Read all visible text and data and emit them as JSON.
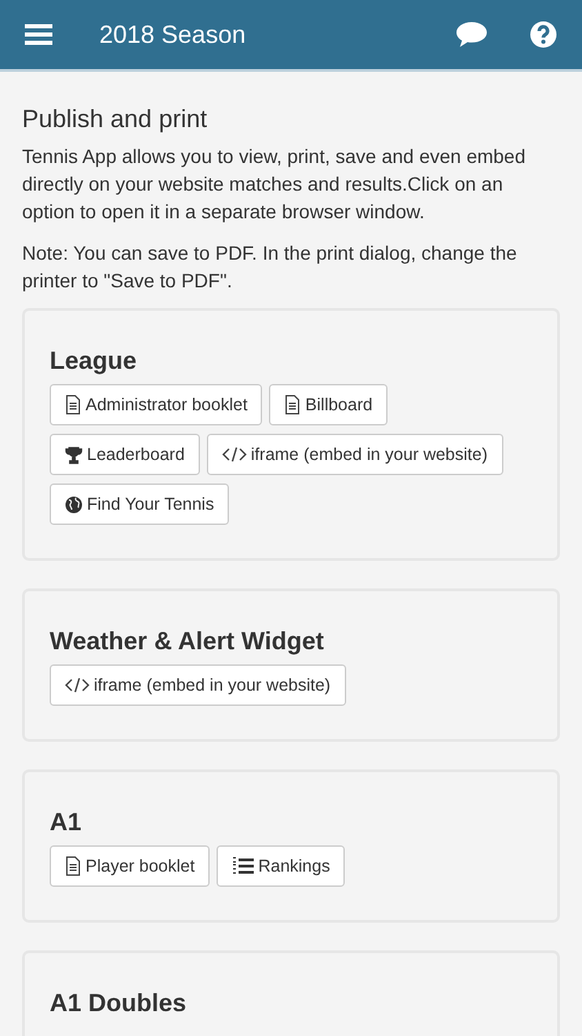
{
  "header": {
    "title": "2018 Season"
  },
  "intro": {
    "heading": "Publish and print",
    "paragraphs": [
      "Tennis App allows you to view, print, save and even embed directly on your website matches and results.Click on an option to open it in a separate browser window.",
      "Note: You can save to PDF. In the print dialog, change the printer to \"Save to PDF\"."
    ]
  },
  "sections": [
    {
      "title": "League",
      "buttons": [
        {
          "kind": "document",
          "label": "Administrator booklet"
        },
        {
          "kind": "document",
          "label": "Billboard"
        },
        {
          "kind": "trophy",
          "label": "Leaderboard"
        },
        {
          "kind": "code",
          "label": "iframe (embed in your website)"
        },
        {
          "kind": "globe",
          "label": "Find Your Tennis"
        }
      ]
    },
    {
      "title": "Weather & Alert Widget",
      "buttons": [
        {
          "kind": "code",
          "label": "iframe (embed in your website)"
        }
      ]
    },
    {
      "title": "A1",
      "buttons": [
        {
          "kind": "document",
          "label": "Player booklet"
        },
        {
          "kind": "list",
          "label": "Rankings"
        }
      ]
    },
    {
      "title": "A1 Doubles"
    }
  ]
}
